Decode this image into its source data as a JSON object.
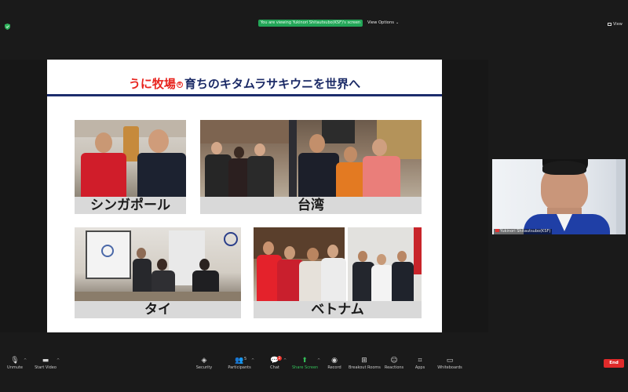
{
  "meeting": {
    "viewing_banner": "You are viewing Yukinori Shitautsubo(KSF)'s screen",
    "view_options_label": "View Options",
    "view_mode_label": "View"
  },
  "slide": {
    "title_red": "うに牧場",
    "title_reg": "R",
    "title_rest": "育ちのキタムラサキウニを世界へ",
    "panels": [
      {
        "caption": "シンガポール"
      },
      {
        "caption": "台湾"
      },
      {
        "caption": "タイ"
      },
      {
        "caption": "ベトナム"
      }
    ]
  },
  "webcam": {
    "participant_name": "Yukinori Shitautsubo(KSF)"
  },
  "toolbar": {
    "items": [
      {
        "label": "Unmute",
        "icon": "mic-muted-icon"
      },
      {
        "label": "Start Video",
        "icon": "video-off-icon"
      },
      {
        "label": "Security",
        "icon": "shield-icon"
      },
      {
        "label": "Participants",
        "icon": "people-icon",
        "count": "5"
      },
      {
        "label": "Chat",
        "icon": "chat-icon",
        "badge": "2"
      },
      {
        "label": "Share Screen",
        "icon": "share-screen-icon"
      },
      {
        "label": "Record",
        "icon": "record-icon"
      },
      {
        "label": "Breakout Rooms",
        "icon": "breakout-rooms-icon"
      },
      {
        "label": "Reactions",
        "icon": "reactions-icon"
      },
      {
        "label": "Apps",
        "icon": "apps-icon"
      },
      {
        "label": "Whiteboards",
        "icon": "whiteboard-icon"
      }
    ],
    "end_label": "End"
  },
  "colors": {
    "accent_green": "#23a658",
    "end_red": "#e02a2a",
    "slide_navy": "#1d2d6d",
    "title_red": "#e8231d"
  }
}
